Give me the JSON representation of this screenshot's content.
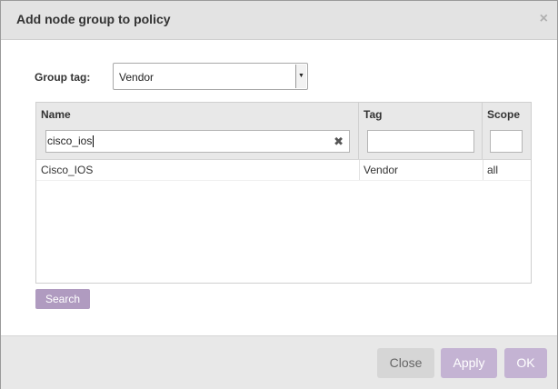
{
  "dialog": {
    "title": "Add node group to policy",
    "close_glyph": "×"
  },
  "group_tag": {
    "label": "Group tag:",
    "selected": "Vendor"
  },
  "grid": {
    "columns": [
      {
        "title": "Name",
        "filter": "cisco_ios"
      },
      {
        "title": "Tag",
        "filter": ""
      },
      {
        "title": "Scope",
        "filter": ""
      }
    ],
    "rows": [
      {
        "name": "Cisco_IOS",
        "tag": "Vendor",
        "scope": "all"
      }
    ]
  },
  "buttons": {
    "search": "Search",
    "close": "Close",
    "apply": "Apply",
    "ok": "OK"
  },
  "icons": {
    "dialog_close": "close-icon",
    "clear_filter": "clear-icon",
    "dropdown": "chevron-down-icon"
  },
  "colors": {
    "accent_button": "#b09bc0",
    "disabled_button": "#c4b3d3"
  }
}
